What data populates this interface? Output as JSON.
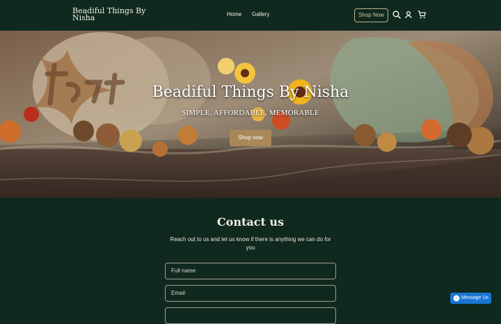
{
  "brand": "Beadiful Things By Nisha",
  "nav": {
    "home": "Home",
    "gallery": "Gallery"
  },
  "header": {
    "shop_button": "Shop Now"
  },
  "hero": {
    "title": "Beadiful Things By Nisha",
    "subtitle": "SIMPLE, AFFORDABLE, MEMORABLE",
    "button": "Shop now"
  },
  "contact": {
    "title": "Contact us",
    "description": "Reach out to us and let us know if there is anything we can do for you",
    "name_placeholder": "Full name",
    "email_placeholder": "Email"
  },
  "messenger": {
    "label": "Message Us"
  },
  "colors": {
    "header_bg": "#10291f",
    "accent": "#a98757",
    "messenger": "#1976d2"
  },
  "icons": [
    "search-icon",
    "account-icon",
    "cart-icon",
    "messenger-icon"
  ]
}
